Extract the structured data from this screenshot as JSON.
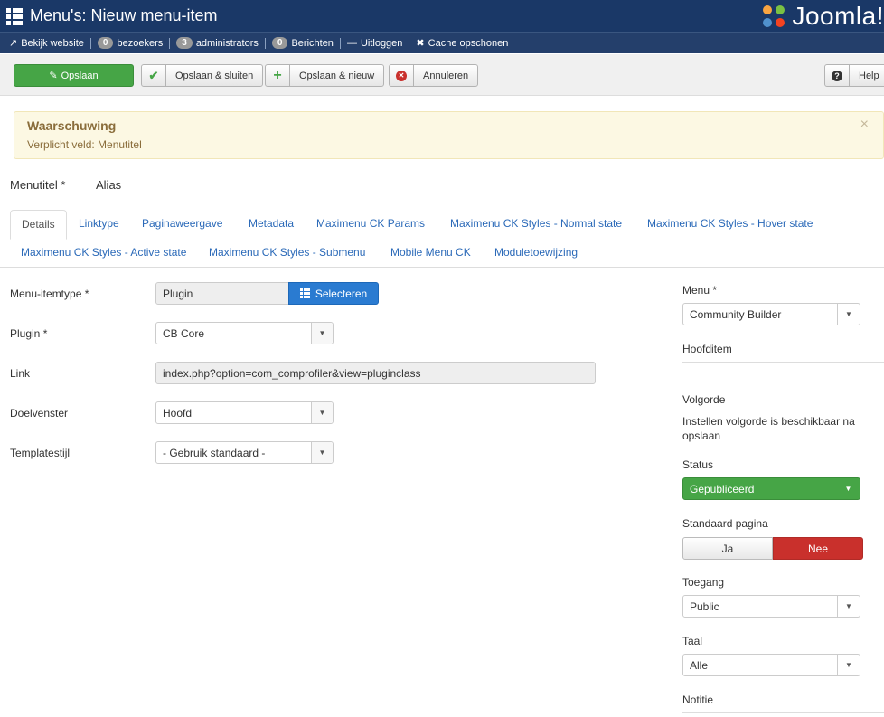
{
  "header": {
    "title": "Menu's: Nieuw menu-item",
    "logo_text": "Joomla!"
  },
  "statusbar": {
    "view_site": "Bekijk website",
    "visitors_count": "0",
    "visitors_label": "bezoekers",
    "admins_count": "3",
    "admins_label": "administrators",
    "messages_count": "0",
    "messages_label": "Berichten",
    "logout": "Uitloggen",
    "clear_cache": "Cache opschonen"
  },
  "toolbar": {
    "save": "Opslaan",
    "save_close": "Opslaan & sluiten",
    "save_new": "Opslaan & nieuw",
    "cancel": "Annuleren",
    "help": "Help"
  },
  "alert": {
    "heading": "Waarschuwing",
    "message": "Verplicht veld: Menutitel"
  },
  "title_row": {
    "menutitle_label": "Menutitel *",
    "alias_label": "Alias"
  },
  "tabs": [
    "Details",
    "Linktype",
    "Paginaweergave",
    "Metadata",
    "Maximenu CK Params",
    "Maximenu CK Styles - Normal state",
    "Maximenu CK Styles - Hover state",
    "Maximenu CK Styles - Active state",
    "Maximenu CK Styles - Submenu",
    "Mobile Menu CK",
    "Moduletoewijzing"
  ],
  "form": {
    "itemtype_label": "Menu-itemtype *",
    "itemtype_value": "Plugin",
    "select_button": "Selecteren",
    "plugin_label": "Plugin *",
    "plugin_value": "CB Core",
    "link_label": "Link",
    "link_value": "index.php?option=com_comprofiler&view=pluginclass",
    "target_label": "Doelvenster",
    "target_value": "Hoofd",
    "template_label": "Templatestijl",
    "template_value": "- Gebruik standaard -"
  },
  "sidebar": {
    "menu_label": "Menu *",
    "menu_value": "Community Builder",
    "parent_label": "Hoofditem",
    "order_label": "Volgorde",
    "order_note": "Instellen volgorde is beschikbaar na opslaan",
    "status_label": "Status",
    "status_value": "Gepubliceerd",
    "home_label": "Standaard pagina",
    "home_yes": "Ja",
    "home_no": "Nee",
    "access_label": "Toegang",
    "access_value": "Public",
    "language_label": "Taal",
    "language_value": "Alle",
    "note_label": "Notitie"
  },
  "colors": {
    "header": "#1a3867",
    "save": "#46a546",
    "primary": "#2a7bd1",
    "danger": "#c9302c",
    "warning_bg": "#fcf8e3"
  }
}
